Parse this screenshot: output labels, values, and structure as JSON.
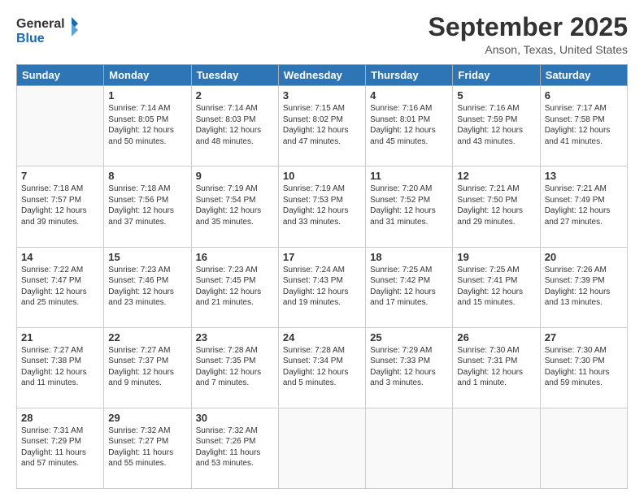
{
  "header": {
    "logo_line1": "General",
    "logo_line2": "Blue",
    "month_title": "September 2025",
    "location": "Anson, Texas, United States"
  },
  "days_of_week": [
    "Sunday",
    "Monday",
    "Tuesday",
    "Wednesday",
    "Thursday",
    "Friday",
    "Saturday"
  ],
  "weeks": [
    [
      {
        "day": "",
        "info": ""
      },
      {
        "day": "1",
        "info": "Sunrise: 7:14 AM\nSunset: 8:05 PM\nDaylight: 12 hours\nand 50 minutes."
      },
      {
        "day": "2",
        "info": "Sunrise: 7:14 AM\nSunset: 8:03 PM\nDaylight: 12 hours\nand 48 minutes."
      },
      {
        "day": "3",
        "info": "Sunrise: 7:15 AM\nSunset: 8:02 PM\nDaylight: 12 hours\nand 47 minutes."
      },
      {
        "day": "4",
        "info": "Sunrise: 7:16 AM\nSunset: 8:01 PM\nDaylight: 12 hours\nand 45 minutes."
      },
      {
        "day": "5",
        "info": "Sunrise: 7:16 AM\nSunset: 7:59 PM\nDaylight: 12 hours\nand 43 minutes."
      },
      {
        "day": "6",
        "info": "Sunrise: 7:17 AM\nSunset: 7:58 PM\nDaylight: 12 hours\nand 41 minutes."
      }
    ],
    [
      {
        "day": "7",
        "info": "Sunrise: 7:18 AM\nSunset: 7:57 PM\nDaylight: 12 hours\nand 39 minutes."
      },
      {
        "day": "8",
        "info": "Sunrise: 7:18 AM\nSunset: 7:56 PM\nDaylight: 12 hours\nand 37 minutes."
      },
      {
        "day": "9",
        "info": "Sunrise: 7:19 AM\nSunset: 7:54 PM\nDaylight: 12 hours\nand 35 minutes."
      },
      {
        "day": "10",
        "info": "Sunrise: 7:19 AM\nSunset: 7:53 PM\nDaylight: 12 hours\nand 33 minutes."
      },
      {
        "day": "11",
        "info": "Sunrise: 7:20 AM\nSunset: 7:52 PM\nDaylight: 12 hours\nand 31 minutes."
      },
      {
        "day": "12",
        "info": "Sunrise: 7:21 AM\nSunset: 7:50 PM\nDaylight: 12 hours\nand 29 minutes."
      },
      {
        "day": "13",
        "info": "Sunrise: 7:21 AM\nSunset: 7:49 PM\nDaylight: 12 hours\nand 27 minutes."
      }
    ],
    [
      {
        "day": "14",
        "info": "Sunrise: 7:22 AM\nSunset: 7:47 PM\nDaylight: 12 hours\nand 25 minutes."
      },
      {
        "day": "15",
        "info": "Sunrise: 7:23 AM\nSunset: 7:46 PM\nDaylight: 12 hours\nand 23 minutes."
      },
      {
        "day": "16",
        "info": "Sunrise: 7:23 AM\nSunset: 7:45 PM\nDaylight: 12 hours\nand 21 minutes."
      },
      {
        "day": "17",
        "info": "Sunrise: 7:24 AM\nSunset: 7:43 PM\nDaylight: 12 hours\nand 19 minutes."
      },
      {
        "day": "18",
        "info": "Sunrise: 7:25 AM\nSunset: 7:42 PM\nDaylight: 12 hours\nand 17 minutes."
      },
      {
        "day": "19",
        "info": "Sunrise: 7:25 AM\nSunset: 7:41 PM\nDaylight: 12 hours\nand 15 minutes."
      },
      {
        "day": "20",
        "info": "Sunrise: 7:26 AM\nSunset: 7:39 PM\nDaylight: 12 hours\nand 13 minutes."
      }
    ],
    [
      {
        "day": "21",
        "info": "Sunrise: 7:27 AM\nSunset: 7:38 PM\nDaylight: 12 hours\nand 11 minutes."
      },
      {
        "day": "22",
        "info": "Sunrise: 7:27 AM\nSunset: 7:37 PM\nDaylight: 12 hours\nand 9 minutes."
      },
      {
        "day": "23",
        "info": "Sunrise: 7:28 AM\nSunset: 7:35 PM\nDaylight: 12 hours\nand 7 minutes."
      },
      {
        "day": "24",
        "info": "Sunrise: 7:28 AM\nSunset: 7:34 PM\nDaylight: 12 hours\nand 5 minutes."
      },
      {
        "day": "25",
        "info": "Sunrise: 7:29 AM\nSunset: 7:33 PM\nDaylight: 12 hours\nand 3 minutes."
      },
      {
        "day": "26",
        "info": "Sunrise: 7:30 AM\nSunset: 7:31 PM\nDaylight: 12 hours\nand 1 minute."
      },
      {
        "day": "27",
        "info": "Sunrise: 7:30 AM\nSunset: 7:30 PM\nDaylight: 11 hours\nand 59 minutes."
      }
    ],
    [
      {
        "day": "28",
        "info": "Sunrise: 7:31 AM\nSunset: 7:29 PM\nDaylight: 11 hours\nand 57 minutes."
      },
      {
        "day": "29",
        "info": "Sunrise: 7:32 AM\nSunset: 7:27 PM\nDaylight: 11 hours\nand 55 minutes."
      },
      {
        "day": "30",
        "info": "Sunrise: 7:32 AM\nSunset: 7:26 PM\nDaylight: 11 hours\nand 53 minutes."
      },
      {
        "day": "",
        "info": ""
      },
      {
        "day": "",
        "info": ""
      },
      {
        "day": "",
        "info": ""
      },
      {
        "day": "",
        "info": ""
      }
    ]
  ]
}
